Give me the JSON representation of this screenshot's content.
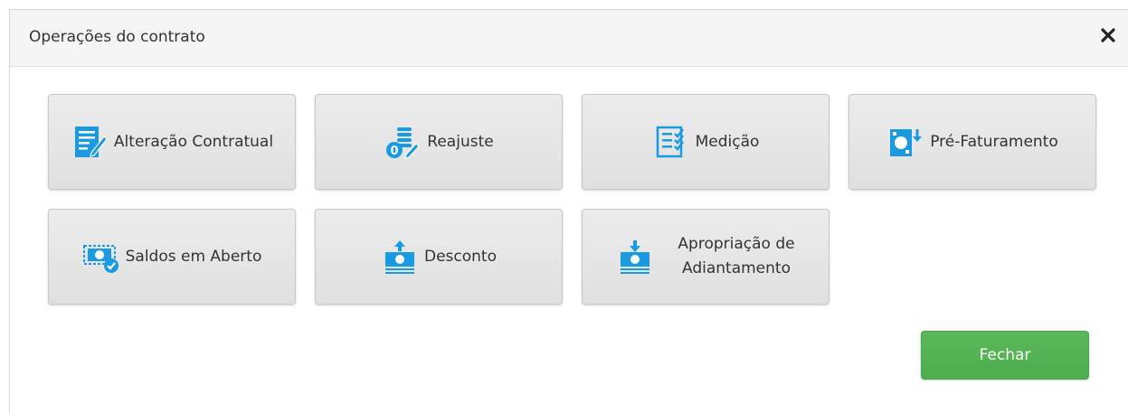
{
  "modal": {
    "title": "Operações do contrato",
    "close_icon": "close-icon",
    "accent_color": "#1a9ae0",
    "buttons": [
      {
        "id": "alteracao",
        "label": "Alteração Contratual",
        "icon": "contract-edit-icon"
      },
      {
        "id": "reajuste",
        "label": "Reajuste",
        "icon": "coins-adjust-icon"
      },
      {
        "id": "medicao",
        "label": "Medição",
        "icon": "checklist-icon"
      },
      {
        "id": "pre-faturamento",
        "label": "Pré-Faturamento",
        "icon": "bill-download-icon"
      },
      {
        "id": "saldos",
        "label": "Saldos em Aberto",
        "icon": "money-check-icon"
      },
      {
        "id": "desconto",
        "label": "Desconto",
        "icon": "money-upload-icon"
      },
      {
        "id": "apropriacao",
        "label_line1": "Apropriação de",
        "label_line2": "Adiantamento",
        "icon": "money-stack-download-icon"
      }
    ],
    "footer": {
      "close_label": "Fechar",
      "close_color": "#5cb85c"
    }
  }
}
